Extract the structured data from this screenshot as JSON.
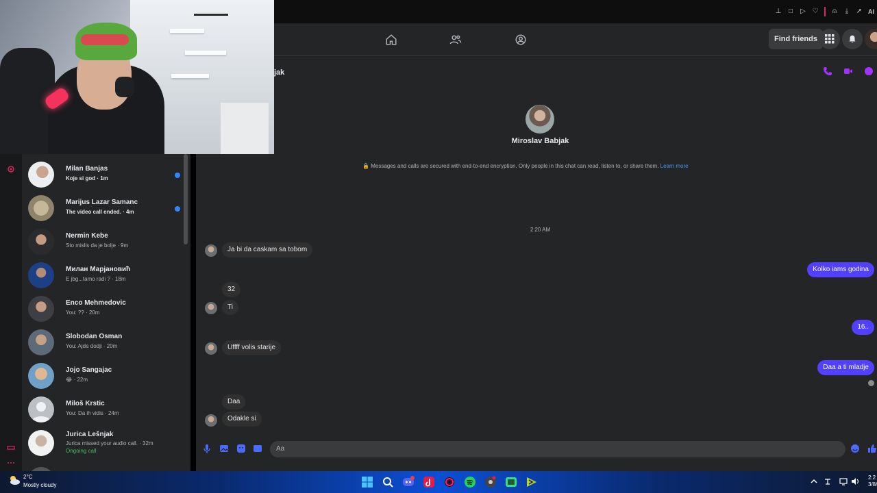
{
  "browser": {
    "toolbar_icons": [
      "pin-icon",
      "window-icon",
      "play-icon",
      "heart-icon",
      "user-icon",
      "download-icon",
      "send-icon"
    ],
    "ai_label": "AI"
  },
  "header": {
    "nav_icons": [
      "home-icon",
      "friends-icon",
      "groups-icon"
    ],
    "find_friends_label": "Find friends",
    "right_icons": [
      "menu-grid-icon",
      "notifications-icon",
      "profile-avatar"
    ]
  },
  "chat": {
    "title_partial": "jak",
    "contact_name": "Miroslav Babjak",
    "encryption_text": "Messages and calls are secured with end-to-end encryption. Only people in this chat can read, listen to, or share them.",
    "learn_more": "Learn more",
    "timestamp": "2:20 AM",
    "messages": [
      {
        "from": "them",
        "text": "Ja bi da caskam sa tobom"
      },
      {
        "from": "me",
        "text": "Kolko iams godina"
      },
      {
        "from": "them",
        "text": "32"
      },
      {
        "from": "them",
        "text": "Ti"
      },
      {
        "from": "me",
        "text": "16.."
      },
      {
        "from": "them",
        "text": "Uffff volis starije"
      },
      {
        "from": "me",
        "text": "Daa a ti mladje"
      },
      {
        "from": "them",
        "text": "Daa"
      },
      {
        "from": "them",
        "text": "Odakle si"
      }
    ],
    "composer_placeholder": "Aa",
    "accent_color": "#5141ff"
  },
  "sidebar": {
    "conversations": [
      {
        "name": "Milan Banjas",
        "preview": "Koje si god · 1m",
        "unread": true
      },
      {
        "name": "Marijus Lazar Samanc",
        "preview": "The video call ended. · 4m",
        "unread": true
      },
      {
        "name": "Nermin Kebe",
        "preview": "Sto mislis da je bolje · 9m",
        "unread": false
      },
      {
        "name": "Милан Марјановић",
        "preview": "E jbg...tamo radi ? · 18m",
        "unread": false
      },
      {
        "name": "Enco Mehmedovic",
        "preview": "You: ?? · 20m",
        "unread": false
      },
      {
        "name": "Slobodan Osman",
        "preview": "You: Ajde dodji · 20m",
        "unread": false
      },
      {
        "name": "Jojo Sangajac",
        "preview": "😂 · 22m",
        "unread": false
      },
      {
        "name": "Miloš Krstic",
        "preview": "You: Da ih vidis · 24m",
        "unread": false
      },
      {
        "name": "Jurica Lešnjak",
        "preview": "Jurica missed your audio call. · 32m",
        "extra": "Ongoing call",
        "unread": false
      }
    ]
  },
  "taskbar": {
    "weather_temp": "2°C",
    "weather_condition": "Mostly cloudy",
    "apps": [
      "windows-start-icon",
      "search-icon",
      "discord-icon",
      "tiktok-icon",
      "browser-icon",
      "spotify-icon",
      "chrome-icon",
      "android-studio-icon",
      "terminal-icon"
    ],
    "clock_time": "2:2",
    "clock_date": "3/8/"
  }
}
